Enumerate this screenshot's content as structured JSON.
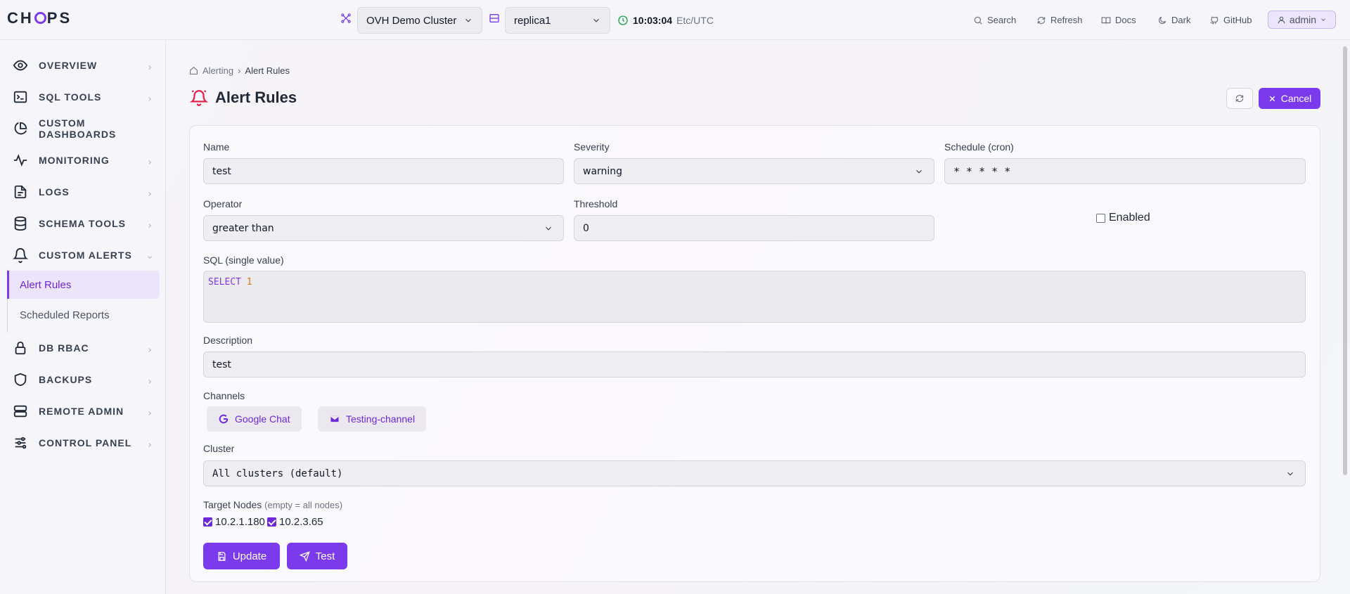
{
  "app": {
    "logo": "CHOPS"
  },
  "topbar": {
    "cluster": "OVH Demo Cluster",
    "replica": "replica1",
    "time": "10:03:04",
    "timezone": "Etc/UTC",
    "nav": {
      "search": "Search",
      "refresh": "Refresh",
      "docs": "Docs",
      "dark": "Dark",
      "github": "GitHub"
    },
    "user": "admin"
  },
  "sidebar": {
    "items": [
      {
        "label": "OVERVIEW",
        "icon": "eye-icon"
      },
      {
        "label": "SQL TOOLS",
        "icon": "terminal-icon"
      },
      {
        "label": "CUSTOM DASHBOARDS",
        "icon": "pie-chart-icon"
      },
      {
        "label": "MONITORING",
        "icon": "activity-icon"
      },
      {
        "label": "LOGS",
        "icon": "file-icon"
      },
      {
        "label": "SCHEMA TOOLS",
        "icon": "database-icon"
      },
      {
        "label": "CUSTOM ALERTS",
        "icon": "bell-icon"
      },
      {
        "label": "DB RBAC",
        "icon": "lock-icon"
      },
      {
        "label": "BACKUPS",
        "icon": "shield-icon"
      },
      {
        "label": "REMOTE ADMIN",
        "icon": "server-icon"
      },
      {
        "label": "CONTROL PANEL",
        "icon": "sliders-icon"
      }
    ],
    "sub_items": [
      "Alert Rules",
      "Scheduled Reports"
    ]
  },
  "breadcrumb": {
    "parent": "Alerting",
    "current": "Alert Rules"
  },
  "page": {
    "title": "Alert Rules",
    "cancel": "Cancel"
  },
  "form": {
    "name_label": "Name",
    "name_value": "test",
    "severity_label": "Severity",
    "severity_value": "warning",
    "schedule_label": "Schedule (cron)",
    "schedule_value": "* * * * *",
    "operator_label": "Operator",
    "operator_value": "greater than",
    "threshold_label": "Threshold",
    "threshold_value": "0",
    "enabled_label": "Enabled",
    "enabled": false,
    "sql_label": "SQL (single value)",
    "sql_keyword": "SELECT",
    "sql_number": "1",
    "description_label": "Description",
    "description_value": "test",
    "channels_label": "Channels",
    "channels": [
      "Google Chat",
      "Testing-channel"
    ],
    "cluster_label": "Cluster",
    "cluster_value": "All clusters (default)",
    "target_label": "Target Nodes",
    "target_hint": "(empty = all nodes)",
    "nodes": [
      "10.2.1.180",
      "10.2.3.65"
    ],
    "update_button": "Update",
    "test_button": "Test"
  },
  "colors": {
    "accent": "#7c3aed",
    "alert_icon": "#e11d48"
  }
}
